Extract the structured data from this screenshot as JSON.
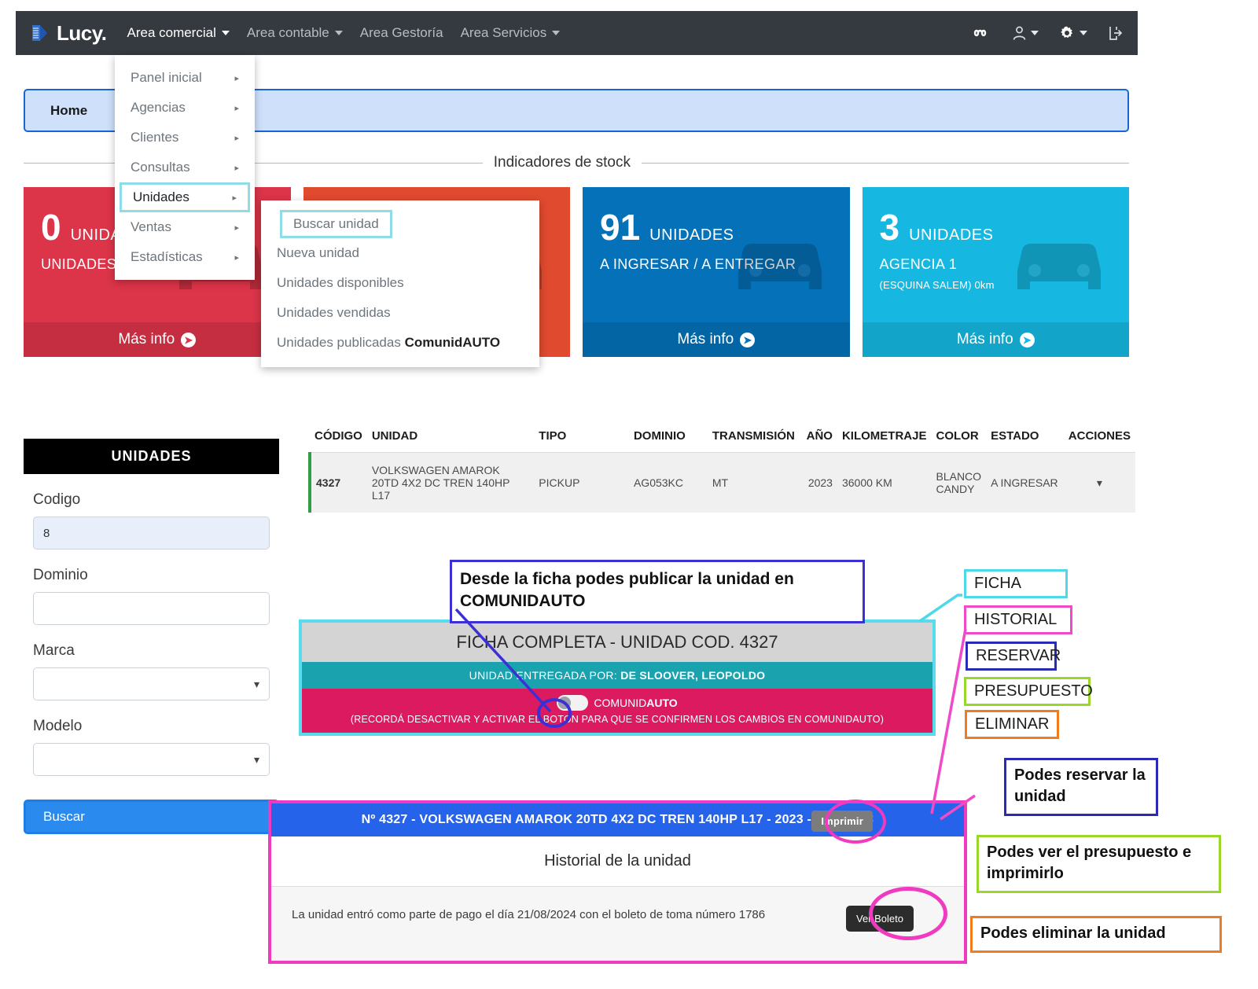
{
  "navbar": {
    "brand": "Lucy.",
    "items": [
      {
        "label": "Area comercial",
        "caret": true,
        "active": true
      },
      {
        "label": "Area contable",
        "caret": true,
        "active": false
      },
      {
        "label": "Area Gestoría",
        "caret": false,
        "active": false
      },
      {
        "label": "Area Servicios",
        "caret": true,
        "active": false
      }
    ],
    "right_icons": [
      {
        "name": "infinity-icon",
        "glyph": "∞"
      },
      {
        "name": "user-icon",
        "glyph": "user"
      },
      {
        "name": "gear-icon",
        "glyph": "gear"
      },
      {
        "name": "logout-icon",
        "glyph": "logout"
      }
    ]
  },
  "breadcrumb": {
    "home": "Home"
  },
  "section": {
    "title": "Indicadores de stock"
  },
  "cards": [
    {
      "number": "0",
      "unit": "UNIDADES",
      "subtitle": "UNIDADES A I",
      "subtitle2": "",
      "more": "Más info",
      "color": "#dc3448"
    },
    {
      "number": "",
      "unit": "",
      "subtitle": "",
      "subtitle2": "",
      "more": "",
      "color": "#e04a2e"
    },
    {
      "number": "91",
      "unit": "UNIDADES",
      "subtitle": "A INGRESAR / A ENTREGAR",
      "subtitle2": "",
      "more": "Más info",
      "color": "#0571b8"
    },
    {
      "number": "3",
      "unit": "UNIDADES",
      "subtitle": "AGENCIA 1",
      "subtitle2": "(ESQUINA SALEM) 0km",
      "more": "Más info",
      "color": "#16b7e0"
    }
  ],
  "menu_primary": {
    "items": [
      {
        "label": "Panel inicial",
        "arrow": "▸",
        "highlighted": false
      },
      {
        "label": "Agencias",
        "arrow": "▸",
        "highlighted": false
      },
      {
        "label": "Clientes",
        "arrow": "▸",
        "highlighted": false
      },
      {
        "label": "Consultas",
        "arrow": "▸",
        "highlighted": false
      },
      {
        "label": "Unidades",
        "arrow": "▸",
        "highlighted": true
      },
      {
        "label": "Ventas",
        "arrow": "▸",
        "highlighted": false
      },
      {
        "label": "Estadísticas",
        "arrow": "▸",
        "highlighted": false
      }
    ]
  },
  "menu_secondary": {
    "items": [
      {
        "label": "Buscar unidad",
        "bold": "",
        "highlighted": true
      },
      {
        "label": "Nueva unidad",
        "bold": "",
        "highlighted": false
      },
      {
        "label": "Unidades disponibles",
        "bold": "",
        "highlighted": false
      },
      {
        "label": "Unidades vendidas",
        "bold": "",
        "highlighted": false
      },
      {
        "label": "Unidades publicadas ",
        "bold": "ComunidAUTO",
        "highlighted": false
      }
    ]
  },
  "search_panel": {
    "title": "UNIDADES",
    "fields": [
      {
        "label": "Codigo",
        "value": "8",
        "type": "text",
        "filled": true
      },
      {
        "label": "Dominio",
        "value": "",
        "type": "text",
        "filled": false
      },
      {
        "label": "Marca",
        "value": "",
        "type": "select",
        "filled": false
      },
      {
        "label": "Modelo",
        "value": "",
        "type": "select",
        "filled": false
      }
    ],
    "button": "Buscar"
  },
  "table": {
    "headers": [
      "CÓDIGO",
      "UNIDAD",
      "TIPO",
      "DOMINIO",
      "TRANSMISIÓN",
      "AÑO",
      "KILOMETRAJE",
      "COLOR",
      "ESTADO",
      "ACCIONES"
    ],
    "rows": [
      {
        "codigo": "4327",
        "unidad": "VOLKSWAGEN AMAROK 20TD 4X2 DC TREN 140HP L17",
        "tipo": "PICKUP",
        "dominio": "AG053KC",
        "transmision": "MT",
        "anio": "2023",
        "kilometraje": "36000 KM",
        "color": "BLANCO CANDY",
        "estado": "A INGRESAR",
        "acciones": "▾"
      }
    ]
  },
  "ficha": {
    "title": "FICHA COMPLETA - UNIDAD COD. 4327",
    "entregada_label": "UNIDAD ENTREGADA POR: ",
    "entregada_value": "DE SLOOVER, LEOPOLDO",
    "toggle_label_1": "COMUNID",
    "toggle_label_2": "AUTO",
    "warning": "(RECORDÁ DESACTIVAR Y ACTIVAR EL BOTON PARA QUE SE CONFIRMEN LOS CAMBIOS EN COMUNIDAUTO)"
  },
  "historial": {
    "header": "Nº 4327 - VOLKSWAGEN AMAROK 20TD 4X2 DC TREN 140HP L17 - 2023 - AG053KC",
    "print_button": "Imprimir",
    "subtitle": "Historial de la unidad",
    "entry": "La unidad entró como parte de pago el día 21/08/2024 con el boleto de toma número 1786",
    "boleto_button": "Ver Boleto"
  },
  "annotations": {
    "comunidauto_note": "Desde la ficha podes publicar la unidad en COMUNIDAUTO",
    "labels": [
      {
        "text": "FICHA",
        "color": "#4fd8e8"
      },
      {
        "text": "HISTORIAL",
        "color": "#ef4bc8"
      },
      {
        "text": "RESERVAR",
        "color": "#2a2ab5"
      },
      {
        "text": "PRESUPUESTO",
        "color": "#9bd72b"
      },
      {
        "text": "ELIMINAR",
        "color": "#f07c1e"
      }
    ],
    "notes": [
      {
        "text": "Podes reservar la unidad",
        "color": "#2a2ab5"
      },
      {
        "text": "Podes ver el presupuesto e imprimirlo",
        "color": "#9bd72b"
      },
      {
        "text": "Podes eliminar la unidad",
        "color": "#f07c1e"
      }
    ]
  }
}
